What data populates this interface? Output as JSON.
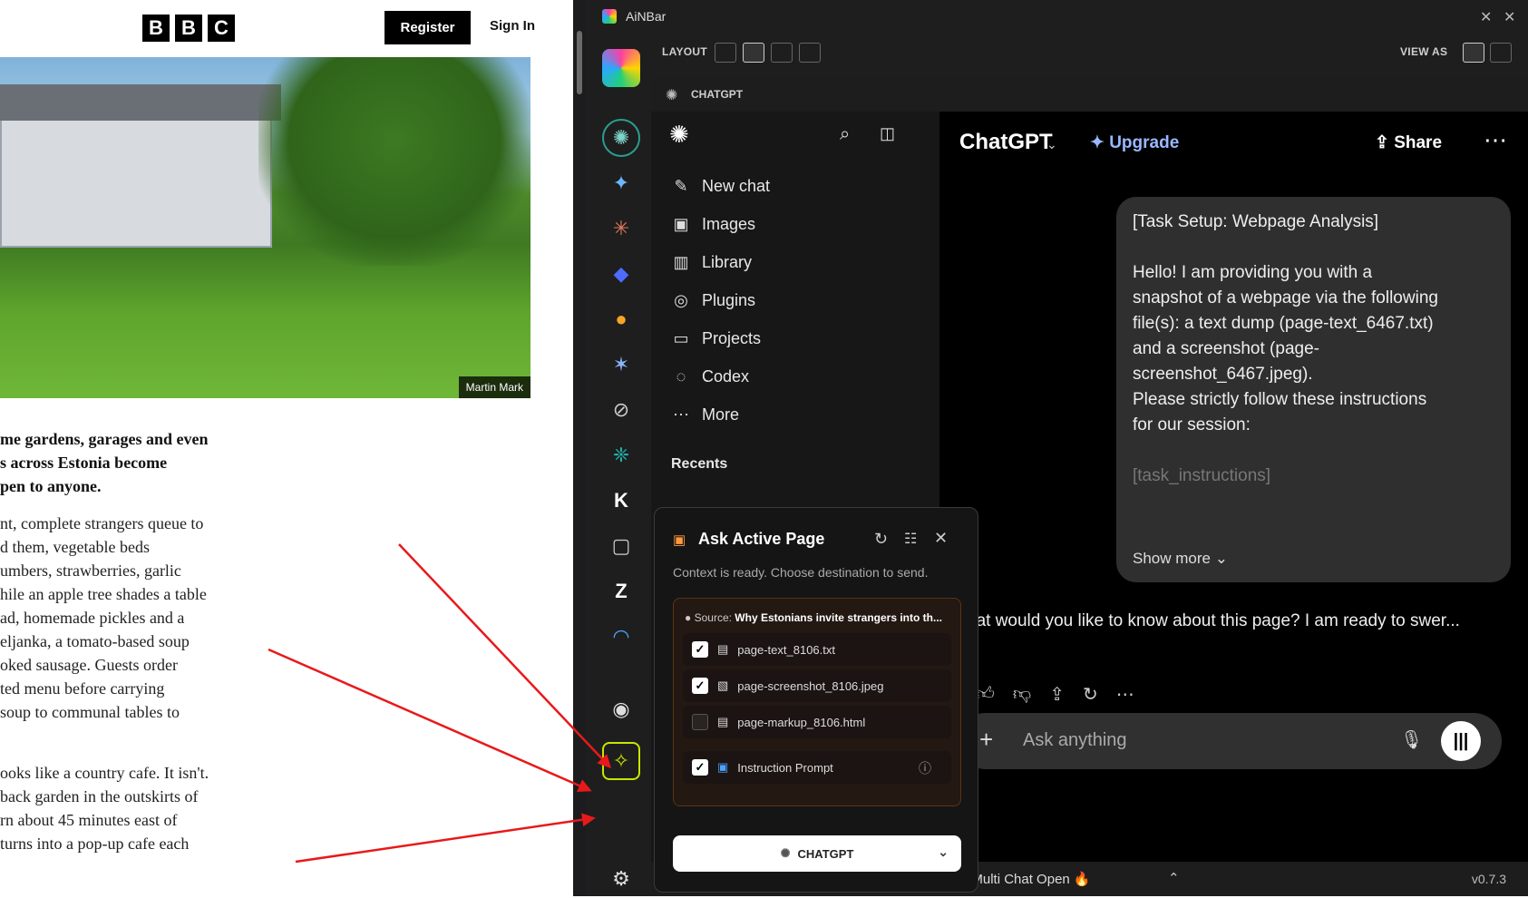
{
  "bbc": {
    "logo": [
      "B",
      "B",
      "C"
    ],
    "register": "Register",
    "sign_in": "Sign In",
    "photo_credit": "Martin Mark",
    "lead": [
      "me gardens, garages and even",
      "s across Estonia become",
      "pen to anyone."
    ],
    "para1": [
      "nt, complete strangers queue to",
      "d them, vegetable beds",
      "umbers, strawberries, garlic",
      "hile an apple tree shades a table",
      "ad, homemade pickles and a",
      "eljanka, a tomato-based soup",
      "oked sausage. Guests order",
      "ted menu before carrying",
      " soup to communal tables to"
    ],
    "para2": [
      "ooks like a country cafe. It isn't.",
      "back garden in the outskirts of",
      "rn about 45 minutes east of",
      "turns into a pop-up cafe each"
    ]
  },
  "app": {
    "title": "AiNBar",
    "layout_label": "LAYOUT",
    "view_as_label": "VIEW AS",
    "version": "v0.7.3",
    "footer_text": "Manual Multi Chat Open 🔥"
  },
  "panel": {
    "title": "CHATGPT"
  },
  "sidebar": {
    "items": [
      {
        "label": "New chat",
        "icon": "edit-icon"
      },
      {
        "label": "Images",
        "icon": "images-icon"
      },
      {
        "label": "Library",
        "icon": "library-icon"
      },
      {
        "label": "Plugins",
        "icon": "plugins-icon"
      },
      {
        "label": "Projects",
        "icon": "folder-icon"
      },
      {
        "label": "Codex",
        "icon": "codex-icon"
      },
      {
        "label": "More",
        "icon": "more-icon"
      }
    ],
    "recents": "Recents"
  },
  "chat": {
    "model": "ChatGPT",
    "upgrade": "Upgrade",
    "share": "Share",
    "user_message": [
      "[Task Setup: Webpage Analysis]",
      "",
      "Hello! I am providing you with a",
      "snapshot of a webpage via the following",
      "file(s): a text dump (page-text_6467.txt)",
      "and a screenshot (page-",
      "screenshot_6467.jpeg).",
      "Please strictly follow these instructions",
      "for our session:",
      "",
      "[task_instructions]"
    ],
    "show_more": "Show more",
    "assistant": "hat would you like to know about this page? I am ready to swer...",
    "input_placeholder": "Ask anything"
  },
  "popup": {
    "title": "Ask Active Page",
    "subtitle": "Context is ready. Choose destination to send.",
    "source_label": "Source:",
    "source_value": "Why Estonians invite strangers into th...",
    "files": [
      {
        "name": "page-text_8106.txt",
        "checked": true
      },
      {
        "name": "page-screenshot_8106.jpeg",
        "checked": true
      },
      {
        "name": "page-markup_8106.html",
        "checked": false
      }
    ],
    "instruction": "Instruction Prompt",
    "send_target": "CHATGPT"
  }
}
